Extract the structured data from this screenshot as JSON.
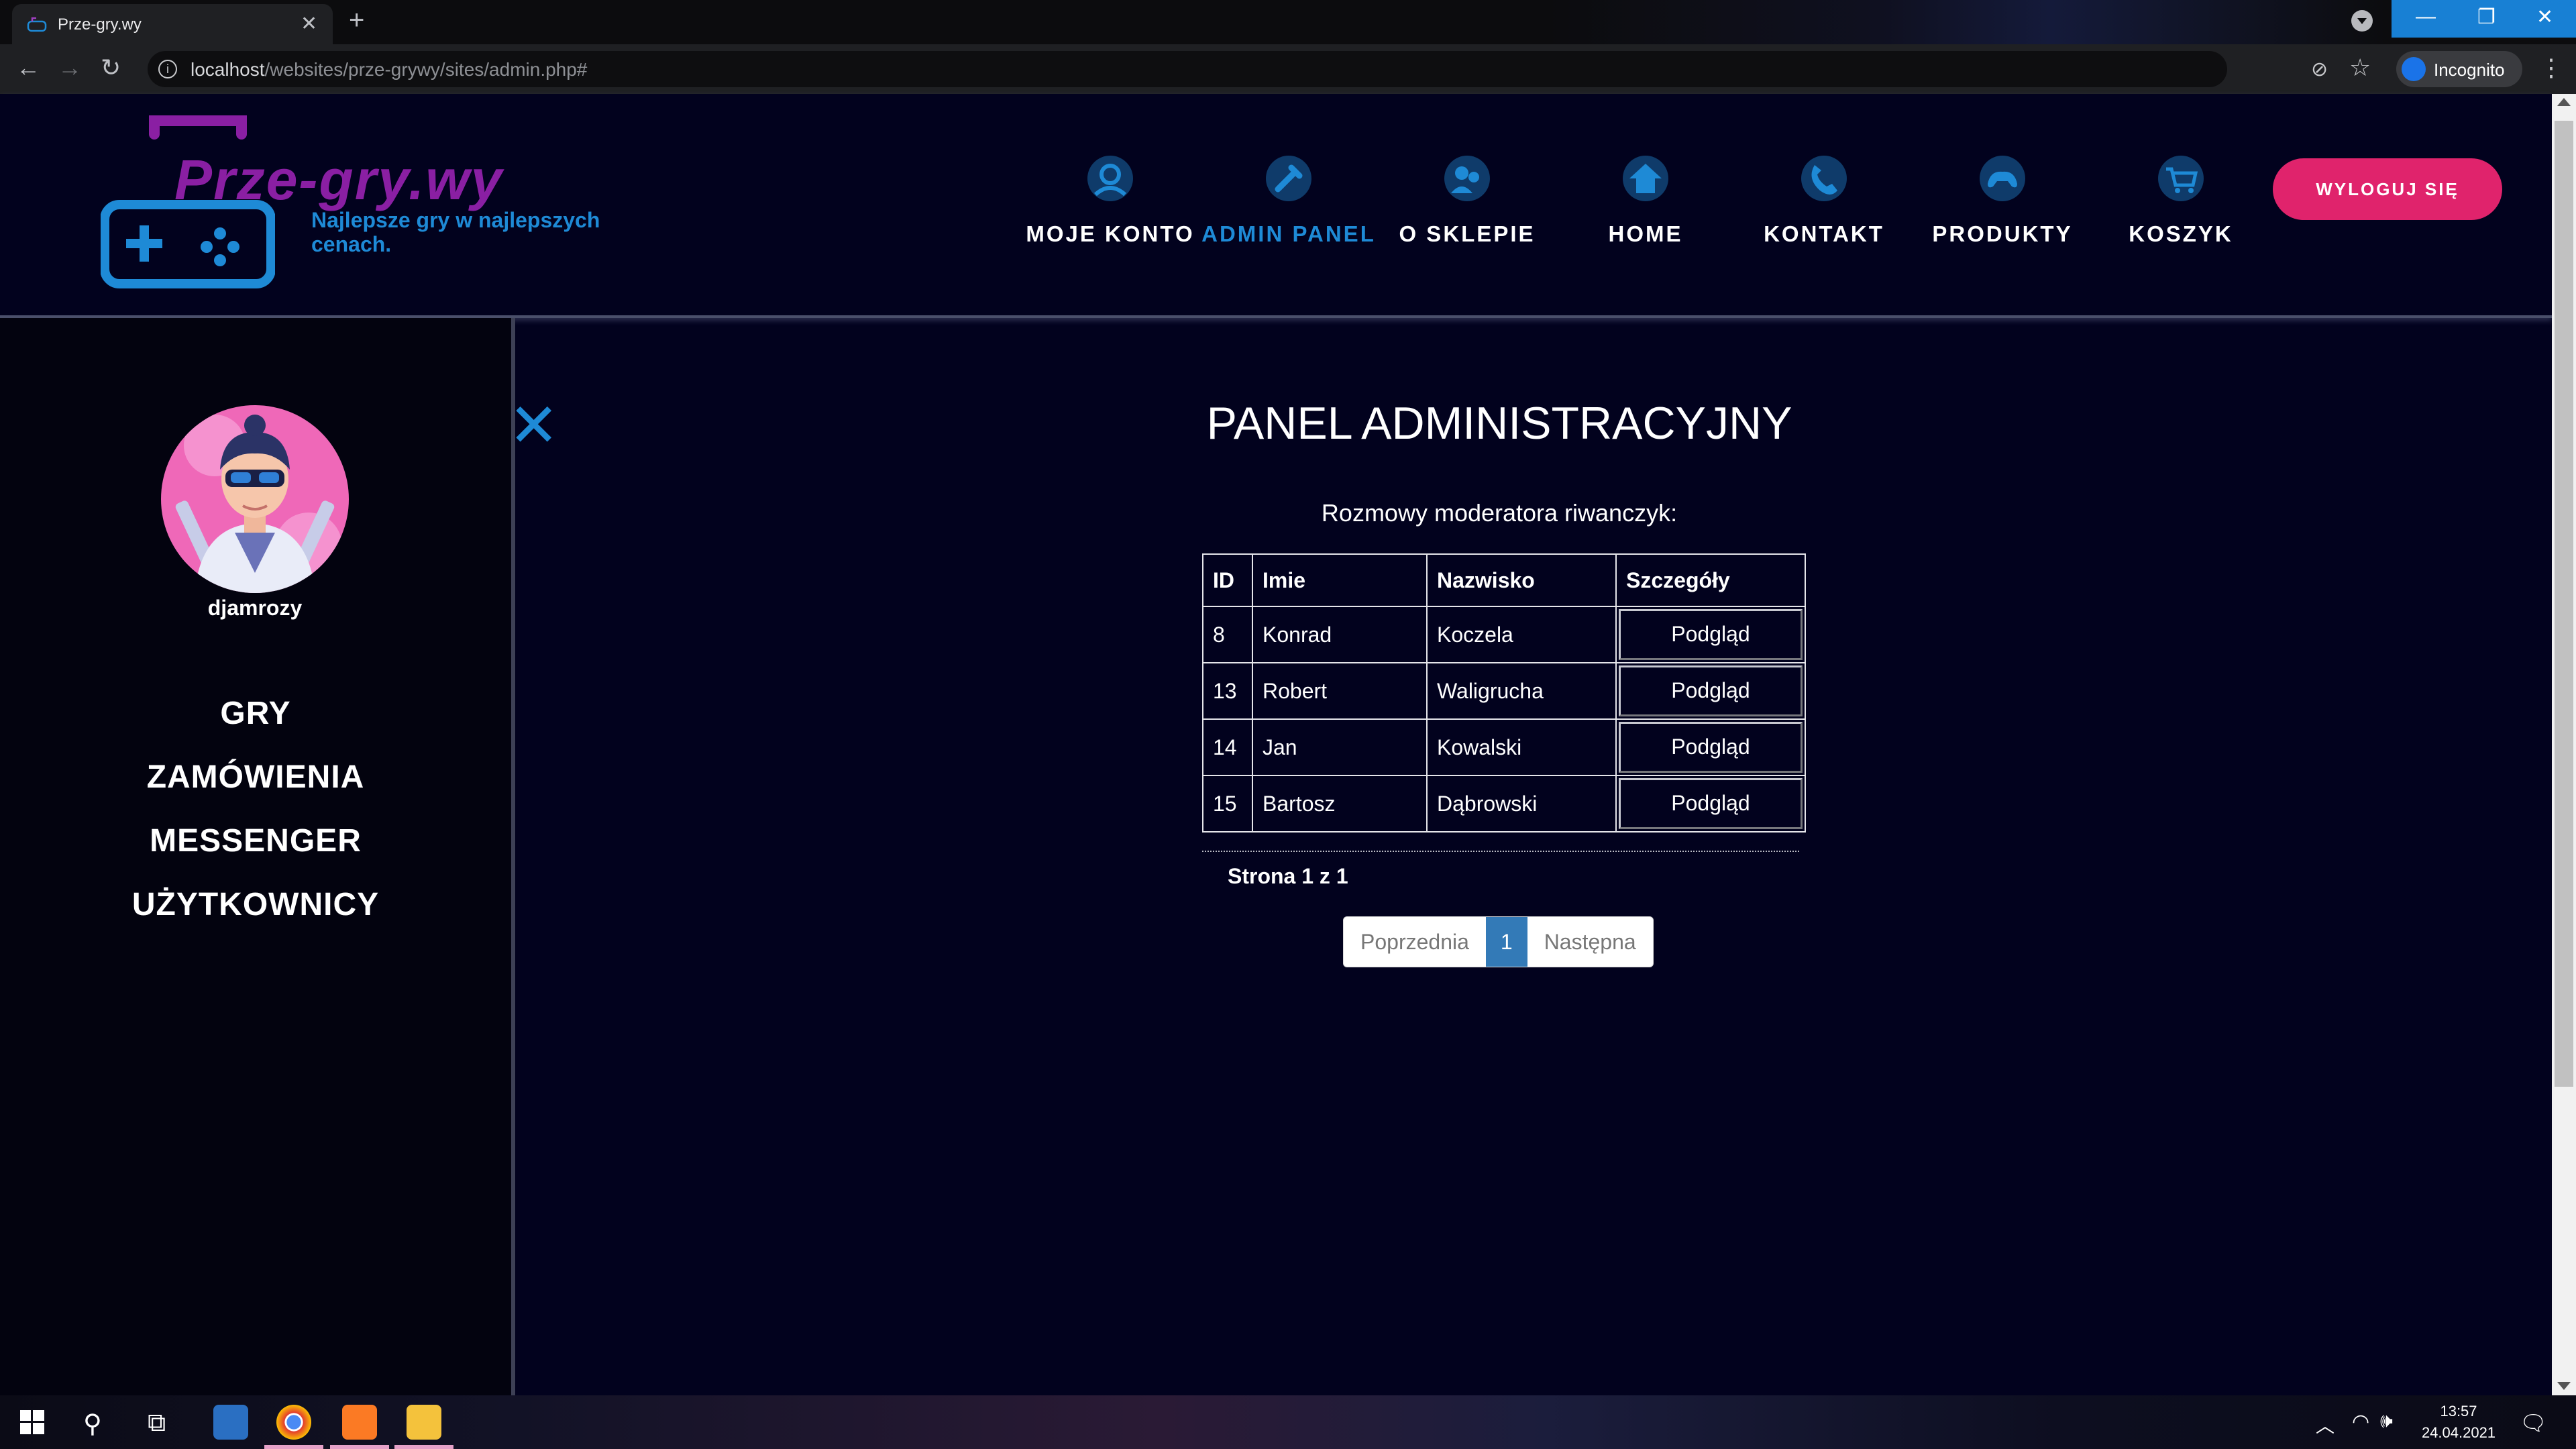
{
  "browser": {
    "tab_title": "Prze-gry.wy",
    "tab_close": "✕",
    "new_tab": "+",
    "url_host": "localhost",
    "url_path": "/websites/prze-grywy/sites/admin.php#",
    "profile_label": "Incognito",
    "window_controls": [
      "—",
      "❐",
      "✕"
    ]
  },
  "site": {
    "logo_text": "Prze-gry.wy",
    "tagline": "Najlepsze gry w najlepszych cenach.",
    "nav": [
      {
        "label": "MOJE KONTO",
        "icon": "account-icon"
      },
      {
        "label": "ADMIN PANEL",
        "icon": "admin-icon",
        "active": true
      },
      {
        "label": "O SKLEPIE",
        "icon": "about-icon"
      },
      {
        "label": "HOME",
        "icon": "home-icon"
      },
      {
        "label": "KONTAKT",
        "icon": "phone-icon"
      },
      {
        "label": "PRODUKTY",
        "icon": "gamepad-icon"
      },
      {
        "label": "KOSZYK",
        "icon": "cart-icon"
      }
    ],
    "logout_label": "WYLOGUJ SIĘ",
    "accent_color": "#1e8ad6",
    "logout_color": "#e0236c"
  },
  "sidebar": {
    "username": "djamrozy",
    "links": [
      "GRY",
      "ZAMÓWIENIA",
      "MESSENGER",
      "UŻYTKOWNICY"
    ]
  },
  "main": {
    "title": "PANEL ADMINISTRACYJNY",
    "subtitle": "Rozmowy moderatora riwanczyk:",
    "table": {
      "headers": [
        "ID",
        "Imie",
        "Nazwisko",
        "Szczegóły"
      ],
      "rows": [
        {
          "id": "8",
          "imie": "Konrad",
          "nazwisko": "Koczela",
          "action": "Podgląd"
        },
        {
          "id": "13",
          "imie": "Robert",
          "nazwisko": "Waligrucha",
          "action": "Podgląd"
        },
        {
          "id": "14",
          "imie": "Jan",
          "nazwisko": "Kowalski",
          "action": "Podgląd"
        },
        {
          "id": "15",
          "imie": "Bartosz",
          "nazwisko": "Dąbrowski",
          "action": "Podgląd"
        }
      ]
    },
    "page_info": "Strona 1 z 1",
    "pagination": {
      "prev": "Poprzednia",
      "current": "1",
      "next": "Następna"
    }
  },
  "taskbar": {
    "time": "13:57",
    "date": "24.04.2021"
  }
}
